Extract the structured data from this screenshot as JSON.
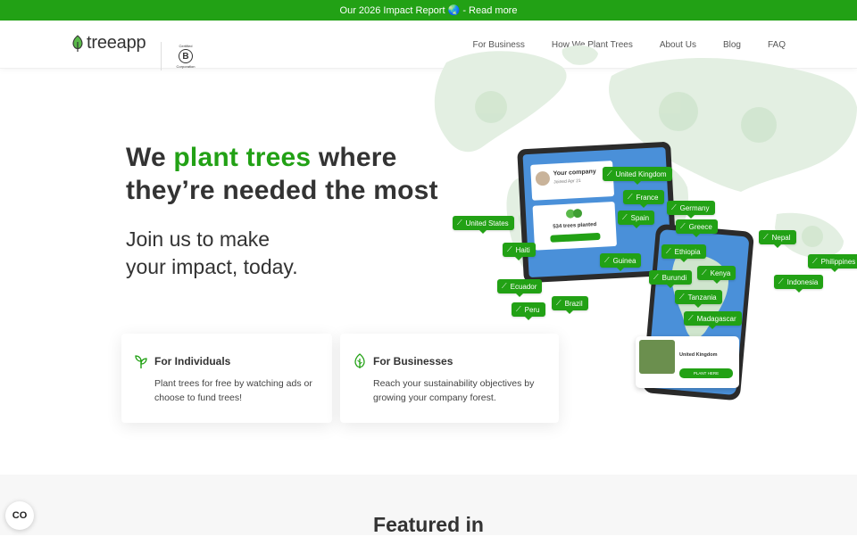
{
  "banner": {
    "text": "Our 2026 Impact Report 🌏 - Read more"
  },
  "header": {
    "logo_text": "treeapp",
    "bcorp_top": "Certified",
    "bcorp_letter": "B",
    "bcorp_bottom": "Corporation",
    "nav": [
      "For Business",
      "How We Plant Trees",
      "About Us",
      "Blog",
      "FAQ"
    ]
  },
  "hero": {
    "headline_pre": "We ",
    "headline_green": "plant trees",
    "headline_post": " where",
    "headline_line2": "they’re needed the most",
    "sub_line1": "Join us to make",
    "sub_line2": "your impact, today."
  },
  "cards": [
    {
      "title": "For Individuals",
      "desc": "Plant trees for free by watching ads or choose to fund trees!",
      "icon": "sprout-icon"
    },
    {
      "title": "For Businesses",
      "desc": "Reach your sustainability objectives by growing your company forest.",
      "icon": "leaf-icon"
    }
  ],
  "map_pins": [
    "United Kingdom",
    "France",
    "Germany",
    "United States",
    "Spain",
    "Greece",
    "Nepal",
    "Haiti",
    "Ethiopia",
    "Philippines",
    "Guinea",
    "Burundi",
    "Kenya",
    "Indonesia",
    "Ecuador",
    "Tanzania",
    "Peru",
    "Brazil",
    "Madagascar"
  ],
  "devices": {
    "tablet_company": "Your company",
    "tablet_joined": "Joined Apr 21",
    "tablet_trees": "534 trees planted",
    "phone_card_label": "United Kingdom",
    "phone_card_button": "PLANT HERE"
  },
  "featured": {
    "title": "Featured in"
  },
  "cookie": {
    "label": "CO"
  },
  "colors": {
    "brand_green": "#22a115",
    "text_dark": "#333333"
  }
}
